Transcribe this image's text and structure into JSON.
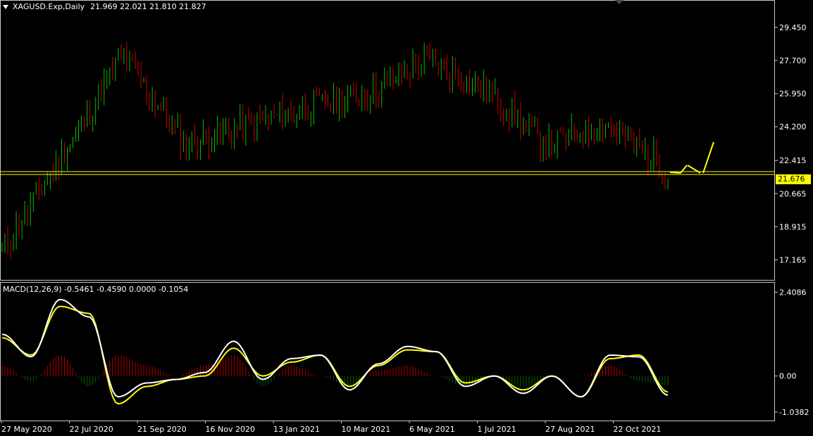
{
  "header": {
    "symbol": "XAGUSD.Exp,Daily",
    "ohlc": "21.969 22.021 21.810 21.827"
  },
  "macd_header": {
    "label": "MACD(12,26,9) -0.5461 -0.4590 0.0000 -0.1054"
  },
  "price_tag": "21.676",
  "colors": {
    "background": "#000000",
    "bull_candle": "#00c000",
    "bear_candle": "#d00000",
    "macd_line": "#ffffff",
    "signal_line": "#ffff00",
    "level_line": "#ffff00",
    "arrow": "#ffff00",
    "grid_separator": "#c0c0c0"
  },
  "chart_data": [
    {
      "type": "candlestick",
      "title": "XAGUSD.Exp,Daily",
      "ylim": [
        16.4,
        30.6
      ],
      "y_ticks": [
        "29.450",
        "27.700",
        "25.950",
        "24.200",
        "22.415",
        "20.665",
        "18.915",
        "17.165"
      ],
      "x_ticks": [
        "27 May 2020",
        "22 Jul 2020",
        "21 Sep 2020",
        "16 Nov 2020",
        "13 Jan 2021",
        "10 Mar 2021",
        "6 May 2021",
        "1 Jul 2021",
        "27 Aug 2021",
        "22 Oct 2021"
      ],
      "horizontal_levels": [
        21.676,
        21.827
      ],
      "close_anchors": [
        {
          "x": "27 May 2020",
          "close": 17.6
        },
        {
          "x": "22 Jul 2020",
          "close": 22.7
        },
        {
          "x": "5 Aug 2020",
          "close": 28.0
        },
        {
          "x": "21 Sep 2020",
          "close": 23.3
        },
        {
          "x": "16 Nov 2020",
          "close": 24.2
        },
        {
          "x": "13 Jan 2021",
          "close": 25.2
        },
        {
          "x": "10 Mar 2021",
          "close": 25.9
        },
        {
          "x": "6 May 2021",
          "close": 27.7
        },
        {
          "x": "1 Jul 2021",
          "close": 26.1
        },
        {
          "x": "27 Aug 2021",
          "close": 23.2
        },
        {
          "x": "22 Oct 2021",
          "close": 24.4
        },
        {
          "x": "Dec 2021",
          "close": 21.83
        }
      ]
    },
    {
      "type": "line",
      "title": "MACD(12,26,9)",
      "ylim": [
        -1.24,
        2.6
      ],
      "y_ticks": [
        "2.4086",
        "0.00",
        "-1.0382"
      ],
      "series": [
        {
          "name": "MACD",
          "values": [
            1.2,
            0.55,
            2.2,
            1.7,
            -0.6,
            -0.2,
            -0.1,
            0.1,
            1.0,
            -0.1,
            0.5,
            0.6,
            -0.4,
            0.35,
            0.85,
            0.7,
            -0.3,
            0.0,
            -0.5,
            0.0,
            -0.6,
            0.6,
            0.55,
            -0.55
          ]
        },
        {
          "name": "Signal",
          "values": [
            1.1,
            0.6,
            2.0,
            1.8,
            -0.8,
            -0.3,
            -0.1,
            0.0,
            0.8,
            0.0,
            0.4,
            0.6,
            -0.3,
            0.3,
            0.75,
            0.7,
            -0.2,
            0.0,
            -0.4,
            0.0,
            -0.6,
            0.5,
            0.6,
            -0.46
          ]
        }
      ]
    }
  ]
}
